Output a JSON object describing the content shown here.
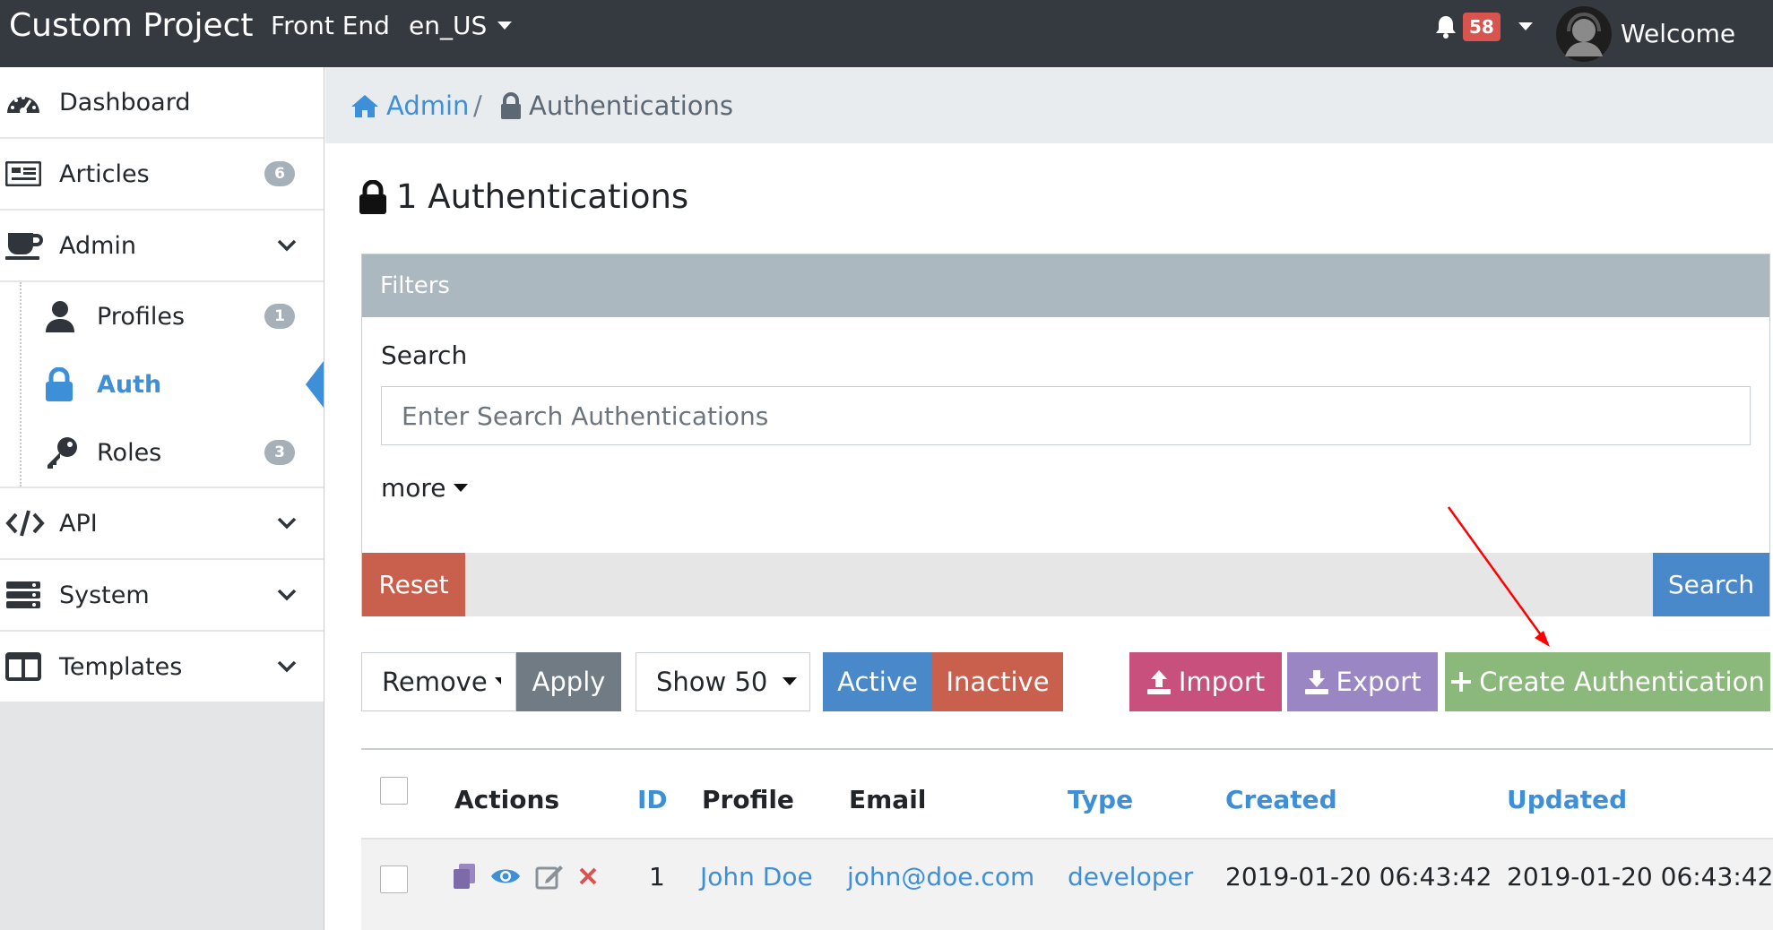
{
  "topbar": {
    "brand": "Custom Project",
    "nav_front_end": "Front End",
    "locale": "en_US",
    "notification_count": "58",
    "welcome": "Welcome"
  },
  "sidebar": {
    "items": [
      {
        "label": "Dashboard",
        "icon": "speedometer-icon"
      },
      {
        "label": "Articles",
        "icon": "newspaper-icon",
        "badge": "6"
      },
      {
        "label": "Admin",
        "icon": "coffee-icon"
      },
      {
        "label": "Profiles",
        "icon": "user-icon",
        "badge": "1"
      },
      {
        "label": "Auth",
        "icon": "lock-icon"
      },
      {
        "label": "Roles",
        "icon": "key-icon",
        "badge": "3"
      },
      {
        "label": "API",
        "icon": "code-icon"
      },
      {
        "label": "System",
        "icon": "server-icon"
      },
      {
        "label": "Templates",
        "icon": "columns-icon"
      }
    ]
  },
  "breadcrumb": {
    "home": "Admin",
    "separator": "/",
    "current": "Authentications"
  },
  "page": {
    "title": "1 Authentications"
  },
  "filters": {
    "header": "Filters",
    "search_label": "Search",
    "search_placeholder": "Enter Search Authentications",
    "more": "more",
    "reset": "Reset",
    "search_button": "Search"
  },
  "toolbar": {
    "bulk_action": "Remove",
    "apply": "Apply",
    "show": "Show 50",
    "active": "Active",
    "inactive": "Inactive",
    "import": "Import",
    "export": "Export",
    "create": "Create Authentication"
  },
  "table": {
    "headers": [
      "Actions",
      "ID",
      "Profile",
      "Email",
      "Type",
      "Created",
      "Updated"
    ],
    "rows": [
      {
        "id": "1",
        "profile": "John Doe",
        "email": "john@doe.com",
        "type": "developer",
        "created": "2019-01-20 06:43:42",
        "updated": "2019-01-20 06:43:42"
      }
    ]
  },
  "colors": {
    "topbar": "#343a40",
    "link": "#3d8fd8",
    "reset": "#c9604e",
    "search": "#4a89c9",
    "apply": "#707b84",
    "active": "#4a89c9",
    "inactive": "#c9604e",
    "import": "#c7507c",
    "export": "#9b86c4",
    "create": "#8bb97b",
    "annotation_arrow": "#ff0000"
  }
}
